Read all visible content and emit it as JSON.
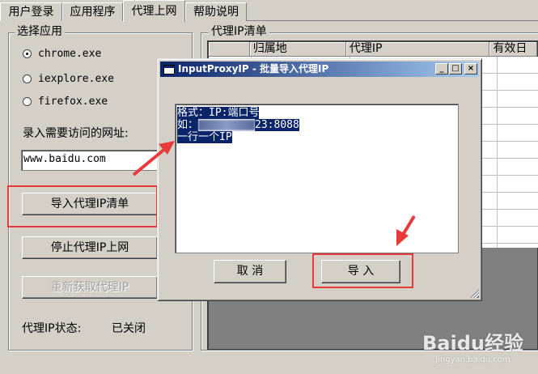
{
  "tabs": [
    {
      "label": "用户登录"
    },
    {
      "label": "应用程序"
    },
    {
      "label": "代理上网"
    },
    {
      "label": "帮助说明"
    }
  ],
  "left_panel": {
    "group_title": "选择应用",
    "apps": [
      {
        "label": "chrome.exe",
        "selected": true
      },
      {
        "label": "iexplore.exe",
        "selected": false
      },
      {
        "label": "firefox.exe",
        "selected": false
      }
    ],
    "url_label": "录入需要访问的网址:",
    "url_value": "www.baidu.com",
    "import_button": "导入代理IP清单",
    "stop_button": "停止代理IP上网",
    "refetch_button": "重新获取代理IP",
    "status_label": "代理IP状态:",
    "status_value": "已关闭"
  },
  "right_panel": {
    "group_title": "代理IP清单",
    "columns": [
      "",
      "归属地",
      "代理IP",
      "有效日"
    ]
  },
  "dialog": {
    "title": "InputProxyIP - 批量导入代理IP",
    "memo_lines": {
      "line1": "格式：IP:端口号",
      "line2_prefix": "如：",
      "line2_suffix": "23:8088",
      "line3": "一行一个IP"
    },
    "cancel_button": "取 消",
    "import_button": "导 入"
  },
  "watermark": {
    "brand": "Baidu经验",
    "url": "jingyan.baidu.com"
  },
  "colors": {
    "window_bg": "#d4d0c8",
    "titlebar_start": "#0a246a",
    "titlebar_end": "#a6caf0",
    "selection": "#0a246a",
    "highlight_red": "#e83a3a"
  }
}
